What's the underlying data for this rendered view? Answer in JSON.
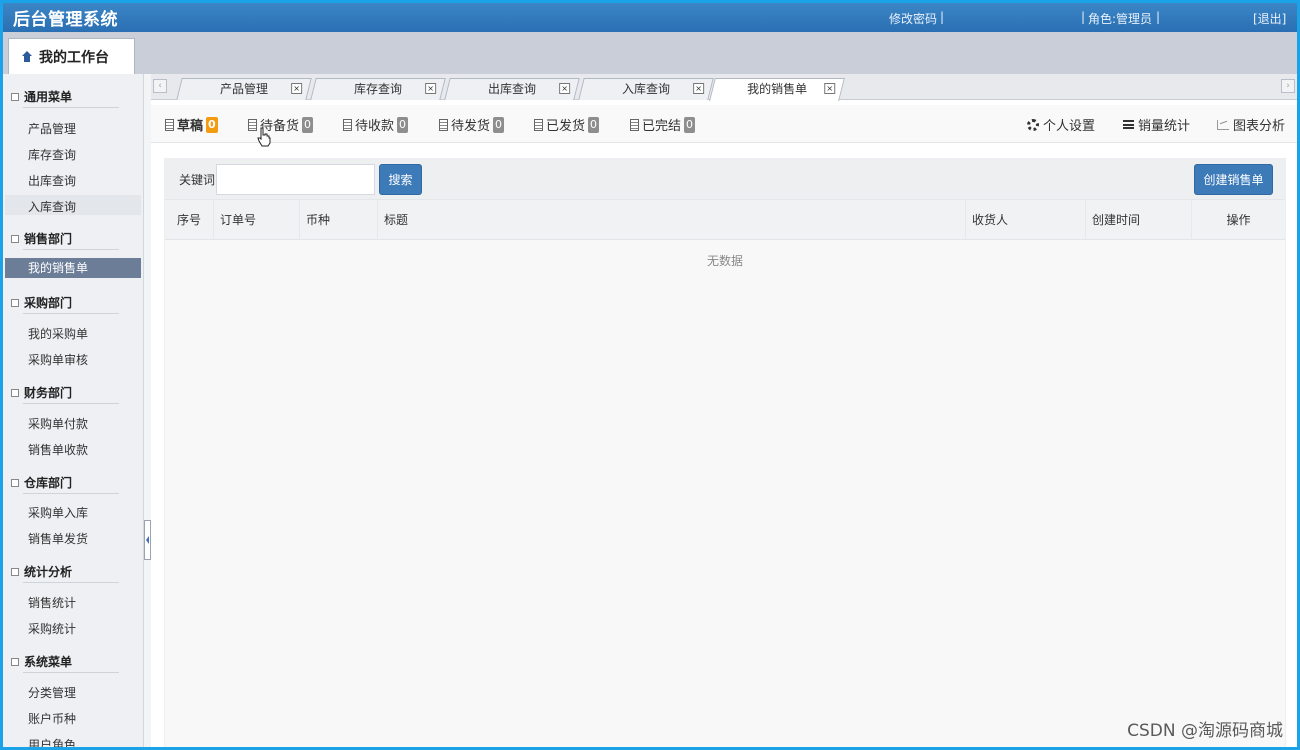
{
  "app": {
    "title": "后台管理系统",
    "change_password": "修改密码",
    "role": "角色:管理员",
    "logout": "[退出]"
  },
  "workbench": {
    "label": "我的工作台"
  },
  "sidebar": {
    "sections": [
      {
        "title": "通用菜单",
        "items": [
          "产品管理",
          "库存查询",
          "出库查询",
          "入库查询"
        ]
      },
      {
        "title": "销售部门",
        "items": [
          "我的销售单"
        ]
      },
      {
        "title": "采购部门",
        "items": [
          "我的采购单",
          "采购单审核"
        ]
      },
      {
        "title": "财务部门",
        "items": [
          "采购单付款",
          "销售单收款"
        ]
      },
      {
        "title": "仓库部门",
        "items": [
          "采购单入库",
          "销售单发货"
        ]
      },
      {
        "title": "统计分析",
        "items": [
          "销售统计",
          "采购统计"
        ]
      },
      {
        "title": "系统菜单",
        "items": [
          "分类管理",
          "账户币种",
          "用户角色"
        ]
      }
    ],
    "active_item": "我的销售单"
  },
  "tabs": [
    {
      "label": "产品管理"
    },
    {
      "label": "库存查询"
    },
    {
      "label": "出库查询"
    },
    {
      "label": "入库查询"
    },
    {
      "label": "我的销售单",
      "active": true
    }
  ],
  "status_filters": [
    {
      "label": "草稿",
      "count": "0",
      "active": true
    },
    {
      "label": "待备货",
      "count": "0"
    },
    {
      "label": "待收款",
      "count": "0"
    },
    {
      "label": "待发货",
      "count": "0"
    },
    {
      "label": "已发货",
      "count": "0"
    },
    {
      "label": "已完结",
      "count": "0"
    }
  ],
  "right_tools": {
    "settings": "个人设置",
    "sales_stats": "销量统计",
    "chart_analysis": "图表分析"
  },
  "search": {
    "label": "关键词",
    "value": "",
    "button": "搜索",
    "create_button": "创建销售单"
  },
  "table": {
    "columns": [
      "序号",
      "订单号",
      "币种",
      "标题",
      "收货人",
      "创建时间",
      "操作"
    ],
    "rows": [],
    "empty_text": "无数据"
  },
  "watermark": "CSDN @淘源码商城",
  "colors": {
    "header": "#2f76ba",
    "accent": "#3d7ab8",
    "active_nav": "#6c7d98",
    "badge_orange": "#f39c12",
    "badge_gray": "#8e8e8e"
  }
}
